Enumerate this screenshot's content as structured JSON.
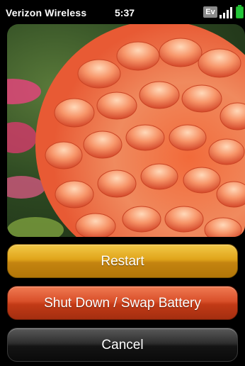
{
  "status_bar": {
    "carrier": "Verizon Wireless",
    "time": "5:37",
    "network_badge": "Ev",
    "signal_icon": "signal-bars-icon",
    "battery_icon": "battery-icon",
    "battery_color": "#22c43a"
  },
  "wallpaper": {
    "subject_icon": "dahlia-flower-photo"
  },
  "actions": {
    "restart_label": "Restart",
    "shutdown_label": "Shut Down / Swap Battery",
    "cancel_label": "Cancel"
  },
  "colors": {
    "restart": "#e0a41a",
    "shutdown": "#d9502a",
    "cancel": "#1a1a1a"
  }
}
